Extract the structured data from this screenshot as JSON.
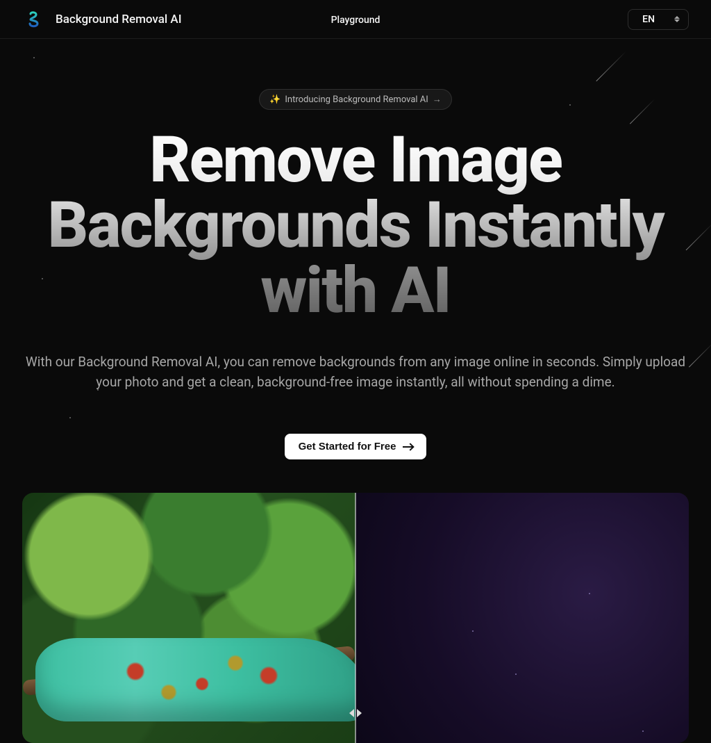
{
  "header": {
    "brand": "Background Removal AI",
    "nav_playground": "Playground",
    "language": "EN"
  },
  "hero": {
    "announcement": "Introducing Background Removal AI",
    "headline": "Remove Image Backgrounds Instantly with AI",
    "subhead": "With our Background Removal AI, you can remove backgrounds from any image online in seconds. Simply upload your photo and get a clean, background-free image instantly, all without spending a dime.",
    "cta_label": "Get Started for Free"
  }
}
